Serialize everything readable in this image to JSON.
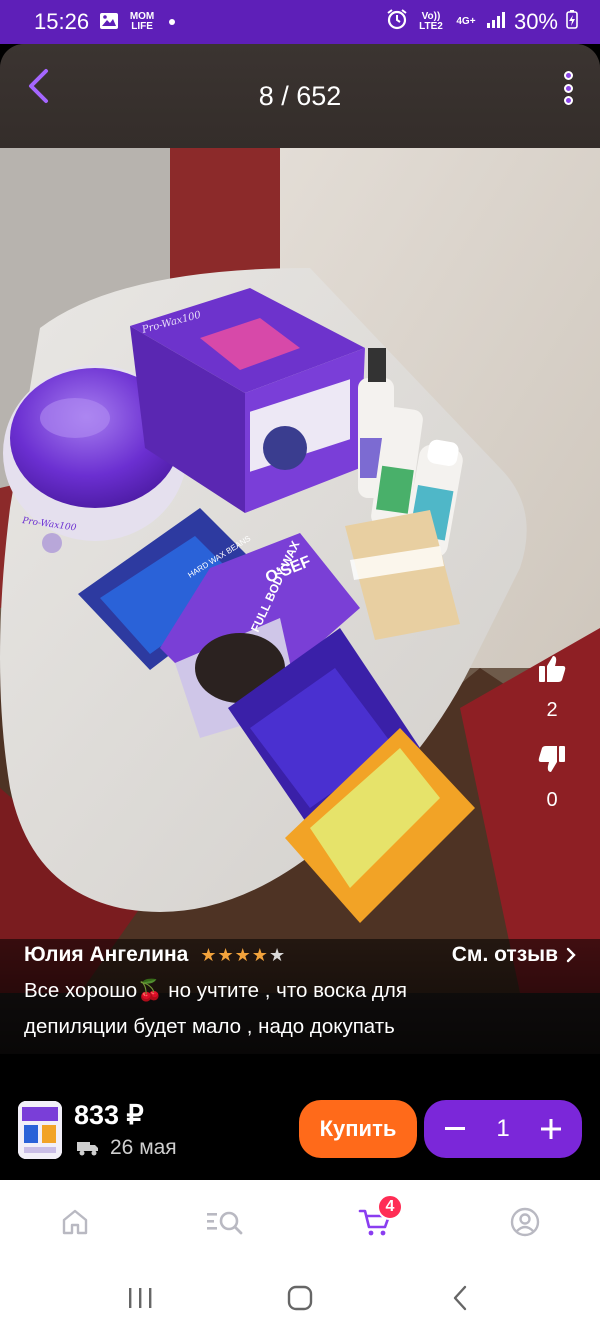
{
  "status_bar": {
    "time": "15:26",
    "app_badge": "MOM LIFE",
    "network": "Vo)) LTE2",
    "network_type": "4G+",
    "battery": "30%"
  },
  "viewer": {
    "counter": "8 / 652",
    "likes": "2",
    "dislikes": "0"
  },
  "photo_labels": {
    "box_brand": "Pro-Wax100",
    "bag_brand": "O'SEF",
    "bag_text": "FULL BODY WAX",
    "beans_label": "HARD WAX BEANS",
    "bottle_label": "O'SEF",
    "warmer_label": "Pro-Wax100"
  },
  "review": {
    "author": "Юлия Ангелина",
    "rating": 4,
    "see_review": "См. отзыв",
    "text_line1": "Все хорошо🍒 но учтите , что воска для",
    "text_line2": "депиляции будет мало , надо докупать"
  },
  "product": {
    "price": "833 ₽",
    "delivery": "26 мая",
    "buy_label": "Купить",
    "quantity": "1"
  },
  "nav": {
    "cart_badge": "4"
  },
  "colors": {
    "accent": "#7b27d9",
    "status_bar": "#5e1fb8",
    "buy": "#ff6a1a",
    "star": "#f2a33c",
    "badge": "#ff2d55"
  }
}
